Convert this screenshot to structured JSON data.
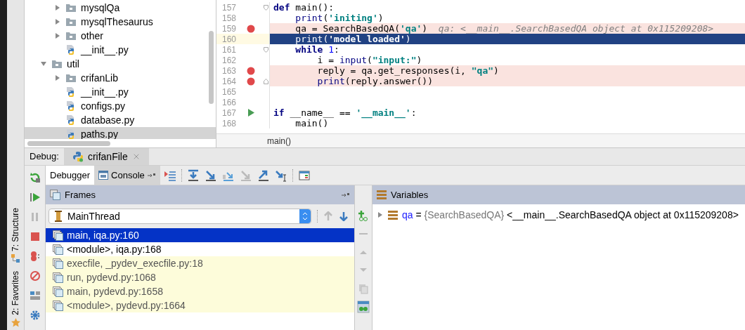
{
  "project_tree": {
    "items": [
      {
        "kind": "hidden",
        "children": [
          {
            "kind": "folder",
            "label": "mysqlQa",
            "expanded": false,
            "selected": false
          },
          {
            "kind": "folder",
            "label": "mysqlThesaurus",
            "expanded": false,
            "selected": false
          },
          {
            "kind": "folder",
            "label": "other",
            "expanded": false,
            "selected": false
          },
          {
            "kind": "python",
            "label": "__init__.py",
            "selected": false
          }
        ]
      },
      {
        "kind": "folder",
        "label": "util",
        "expanded": true,
        "selected": false,
        "children": [
          {
            "kind": "folder",
            "label": "crifanLib",
            "expanded": false,
            "selected": false
          },
          {
            "kind": "python",
            "label": "__init__.py",
            "selected": false
          },
          {
            "kind": "python",
            "label": "configs.py",
            "selected": false
          },
          {
            "kind": "python",
            "label": "database.py",
            "selected": false
          },
          {
            "kind": "python",
            "label": "paths.py",
            "selected": true
          }
        ]
      }
    ]
  },
  "editor": {
    "lines": [
      {
        "number": "157",
        "breakpoint": false,
        "run": false,
        "fold_start": true,
        "fold_end": false,
        "current": false,
        "tokens": [
          {
            "kind": "keyword",
            "text": "def"
          },
          {
            "kind": "plain",
            "text": " main():"
          }
        ]
      },
      {
        "number": "158",
        "breakpoint": false,
        "run": false,
        "fold_start": false,
        "fold_end": false,
        "current": false,
        "tokens": [
          {
            "kind": "builtin",
            "text": "    print"
          },
          {
            "kind": "plain",
            "text": "("
          },
          {
            "kind": "string",
            "text": "'initing'"
          },
          {
            "kind": "plain",
            "text": ")"
          }
        ]
      },
      {
        "number": "159",
        "breakpoint": true,
        "run": false,
        "fold_start": false,
        "fold_end": false,
        "current": false,
        "tokens": [
          {
            "kind": "plain",
            "text": "    qa = SearchBasedQA("
          },
          {
            "kind": "string",
            "text": "'qa'"
          },
          {
            "kind": "plain",
            "text": ")  "
          },
          {
            "kind": "hint",
            "text": "qa: <__main__.SearchBasedQA object at 0x115209208>"
          }
        ]
      },
      {
        "number": "160",
        "breakpoint": false,
        "run": false,
        "fold_start": false,
        "fold_end": false,
        "current": true,
        "tokens": [
          {
            "kind": "builtin",
            "text": "    print"
          },
          {
            "kind": "plain",
            "text": "("
          },
          {
            "kind": "string",
            "text": "'model loaded'"
          },
          {
            "kind": "plain",
            "text": ")"
          }
        ]
      },
      {
        "number": "161",
        "breakpoint": false,
        "run": false,
        "fold_start": true,
        "fold_end": false,
        "current": false,
        "tokens": [
          {
            "kind": "keyword",
            "text": "    while"
          },
          {
            "kind": "number",
            "text": " 1"
          },
          {
            "kind": "plain",
            "text": ":"
          }
        ]
      },
      {
        "number": "162",
        "breakpoint": false,
        "run": false,
        "fold_start": false,
        "fold_end": false,
        "current": false,
        "tokens": [
          {
            "kind": "plain",
            "text": "        i = "
          },
          {
            "kind": "builtin",
            "text": "input"
          },
          {
            "kind": "plain",
            "text": "("
          },
          {
            "kind": "string",
            "text": "\"input:\""
          },
          {
            "kind": "plain",
            "text": ")"
          }
        ]
      },
      {
        "number": "163",
        "breakpoint": true,
        "run": false,
        "fold_start": false,
        "fold_end": false,
        "current": false,
        "tokens": [
          {
            "kind": "plain",
            "text": "        reply = qa.get_responses(i, "
          },
          {
            "kind": "string",
            "text": "\"qa\""
          },
          {
            "kind": "plain",
            "text": ")"
          }
        ]
      },
      {
        "number": "164",
        "breakpoint": true,
        "run": false,
        "fold_start": false,
        "fold_end": true,
        "current": false,
        "tokens": [
          {
            "kind": "builtin",
            "text": "        print"
          },
          {
            "kind": "plain",
            "text": "(reply.answer())"
          }
        ]
      },
      {
        "number": "165",
        "breakpoint": false,
        "run": false,
        "fold_start": false,
        "fold_end": false,
        "current": false
      },
      {
        "number": "166",
        "breakpoint": false,
        "run": false,
        "fold_start": false,
        "fold_end": false,
        "current": false
      },
      {
        "number": "167",
        "breakpoint": false,
        "run": true,
        "fold_start": false,
        "fold_end": false,
        "current": false,
        "tokens": [
          {
            "kind": "keyword",
            "text": "if"
          },
          {
            "kind": "plain",
            "text": " __name__ == "
          },
          {
            "kind": "string",
            "text": "'__main__'"
          },
          {
            "kind": "plain",
            "text": ":"
          }
        ]
      },
      {
        "number": "168",
        "breakpoint": false,
        "run": false,
        "fold_start": false,
        "fold_end": false,
        "current": false,
        "tokens": [
          {
            "kind": "plain",
            "text": "    main()"
          }
        ]
      }
    ],
    "breadcrumb": "main()"
  },
  "side_strip": {
    "tabs": [
      "7: Structure",
      "2: Favorites"
    ]
  },
  "debug": {
    "label": "Debug:",
    "session_tab": {
      "title": "crifanFile",
      "selected": true
    },
    "tabs": [
      {
        "label": "Debugger",
        "selected": true
      },
      {
        "label": "Console",
        "selected": false
      }
    ],
    "frames": {
      "title": "Frames",
      "thread": "MainThread",
      "items": [
        {
          "label": "main, iqa.py:160",
          "kind": "user",
          "selected": true
        },
        {
          "label": "<module>, iqa.py:168",
          "kind": "user",
          "selected": false
        },
        {
          "label": "execfile, _pydev_execfile.py:18",
          "kind": "library",
          "selected": false
        },
        {
          "label": "run, pydevd.py:1068",
          "kind": "library",
          "selected": false
        },
        {
          "label": "main, pydevd.py:1658",
          "kind": "library",
          "selected": false
        },
        {
          "label": "<module>, pydevd.py:1664",
          "kind": "library",
          "selected": false
        }
      ]
    },
    "variables": {
      "title": "Variables",
      "items": [
        {
          "name": "qa",
          "separator": "=",
          "type": "{SearchBasedQA}",
          "value": "<__main__.SearchBasedQA object at 0x115209208>",
          "expanded": false
        }
      ]
    }
  }
}
